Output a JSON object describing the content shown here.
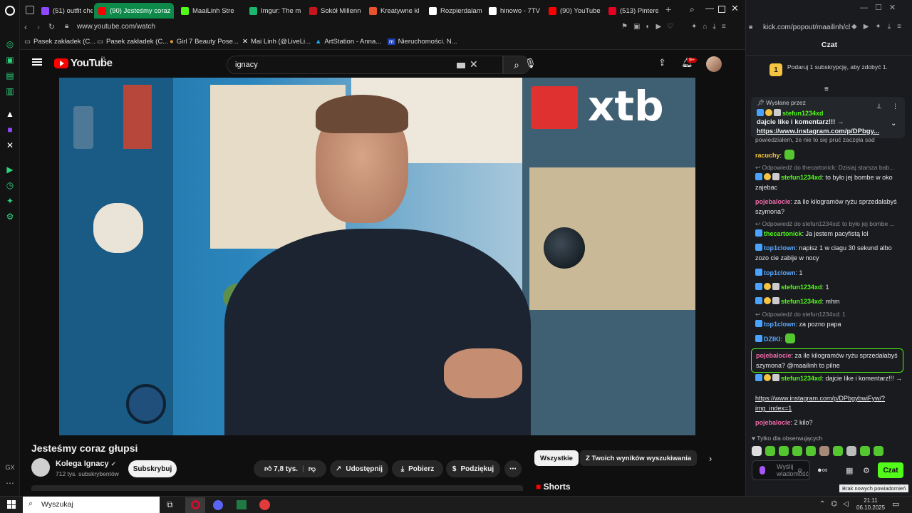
{
  "browser": {
    "tabs": [
      {
        "label": "(51) outfit che",
        "color": "#9146ff"
      },
      {
        "label": "(90) Jesteśmy coraz",
        "color": "#ff0000"
      },
      {
        "label": "MaaiLinh Stre",
        "color": "#53fc18"
      },
      {
        "label": "Imgur: The m",
        "color": "#1bb76e"
      },
      {
        "label": "Sokół Millenn",
        "color": "#c4161c"
      },
      {
        "label": "Kreatywne kl",
        "color": "#e8522c"
      },
      {
        "label": "Rozpierdalam",
        "color": "#ffffff"
      },
      {
        "label": "hinowo - 7TV",
        "color": "#ffffff"
      },
      {
        "label": "(90) YouTube",
        "color": "#ff0000"
      },
      {
        "label": "(513) Pinterest",
        "color": "#e60023"
      }
    ],
    "url": "www.youtube.com/watch",
    "bookmarks": [
      "Pasek zakładek (C...",
      "Pasek zakładek (C...",
      "Girl 7 Beauty Pose...",
      "Mai Linh (@LiveLi...",
      "ArtStation - Anna...",
      "Nieruchomości. N..."
    ]
  },
  "youtube": {
    "logo": "YouTube",
    "region": "PL",
    "search_value": "ignacy",
    "notif_count": "9+",
    "video_brand": "xtb",
    "title": "Jesteśmy coraz głupsi",
    "channel": "Kolega Ignacy",
    "subs": "712 tys. subskrybentów",
    "subscribe": "Subskrybuj",
    "likes": "7,8 tys.",
    "share": "Udostępnij",
    "download": "Pobierz",
    "thanks": "Podziękuj",
    "chips": [
      "Wszystkie",
      "Z Twoich wyników wyszukiwania"
    ],
    "shorts": "Shorts"
  },
  "kick": {
    "url": "kick.com/popout/maailinh/cl",
    "header": "Czat",
    "promo": "Podaruj 1 subskrypcję, aby zdobyć 1.",
    "pinned_label": "Wysłane przez",
    "pinned_user": "stefun1234xd",
    "pinned_text": "dajcie like i komentarz!!! →",
    "pinned_link": "https://www.instagram.com/p/DPbgy...",
    "partial_line": "powiedziałem, że nie to się pruć zaczęła sad",
    "messages": [
      {
        "user": "racuchy",
        "text": ":",
        "cls": "user-y"
      },
      {
        "reply": "Odpowiedź do thecartonick: Dzisiaj starsza bab..."
      },
      {
        "user": "stefun1234xd",
        "text": ": to było jej bombe w oko zajebac",
        "cls": "user-g"
      },
      {
        "user": "pojebalocie",
        "text": ": za ile kilogramów ryżu sprzedałabyś szymona?",
        "cls": "user-p"
      },
      {
        "reply": "Odpowiedź do stefun1234xd: to było jej bombe ..."
      },
      {
        "user": "thecartonick",
        "text": ": Ja jestem pacyfistą lol",
        "cls": "user-g"
      },
      {
        "user": "top1clown",
        "text": ": napisz 1 w ciagu 30 sekund albo zozo cie zabije w nocy",
        "cls": "user-b"
      },
      {
        "user": "top1clown",
        "text": ": 1",
        "cls": "user-b"
      },
      {
        "user": "stefun1234xd",
        "text": ": 1",
        "cls": "user-g"
      },
      {
        "user": "stefun1234xd",
        "text": ": mhm",
        "cls": "user-g"
      },
      {
        "reply": "Odpowiedź do stefun1234xd: 1"
      },
      {
        "user": "top1clown",
        "text": ": za pozno papa",
        "cls": "user-b"
      },
      {
        "user": "DZIKI",
        "text": ":",
        "cls": "user-b"
      },
      {
        "user": "pojebalocie",
        "text": ": za ile kilogramów ryżu sprzedałabyś szymona? @maailinh to pilne",
        "cls": "user-p"
      },
      {
        "user": "stefun1234xd",
        "text": ": dajcie like i komentarz!!! →",
        "cls": "user-g"
      },
      {
        "link": "https://www.instagram.com/p/DPbgybwiFyw/?img_index=1"
      },
      {
        "user": "pojebalocie",
        "text": ": 2 kilo?",
        "cls": "user-p"
      }
    ],
    "followers_only": "Tylko dla obserwujących",
    "input_placeholder": "Wyślij wiadomość",
    "send": "Czat"
  },
  "taskbar": {
    "search": "Wyszukaj",
    "time": "21:11",
    "date": "06.10.2025",
    "tooltip": "Brak nowych powiadomień"
  }
}
